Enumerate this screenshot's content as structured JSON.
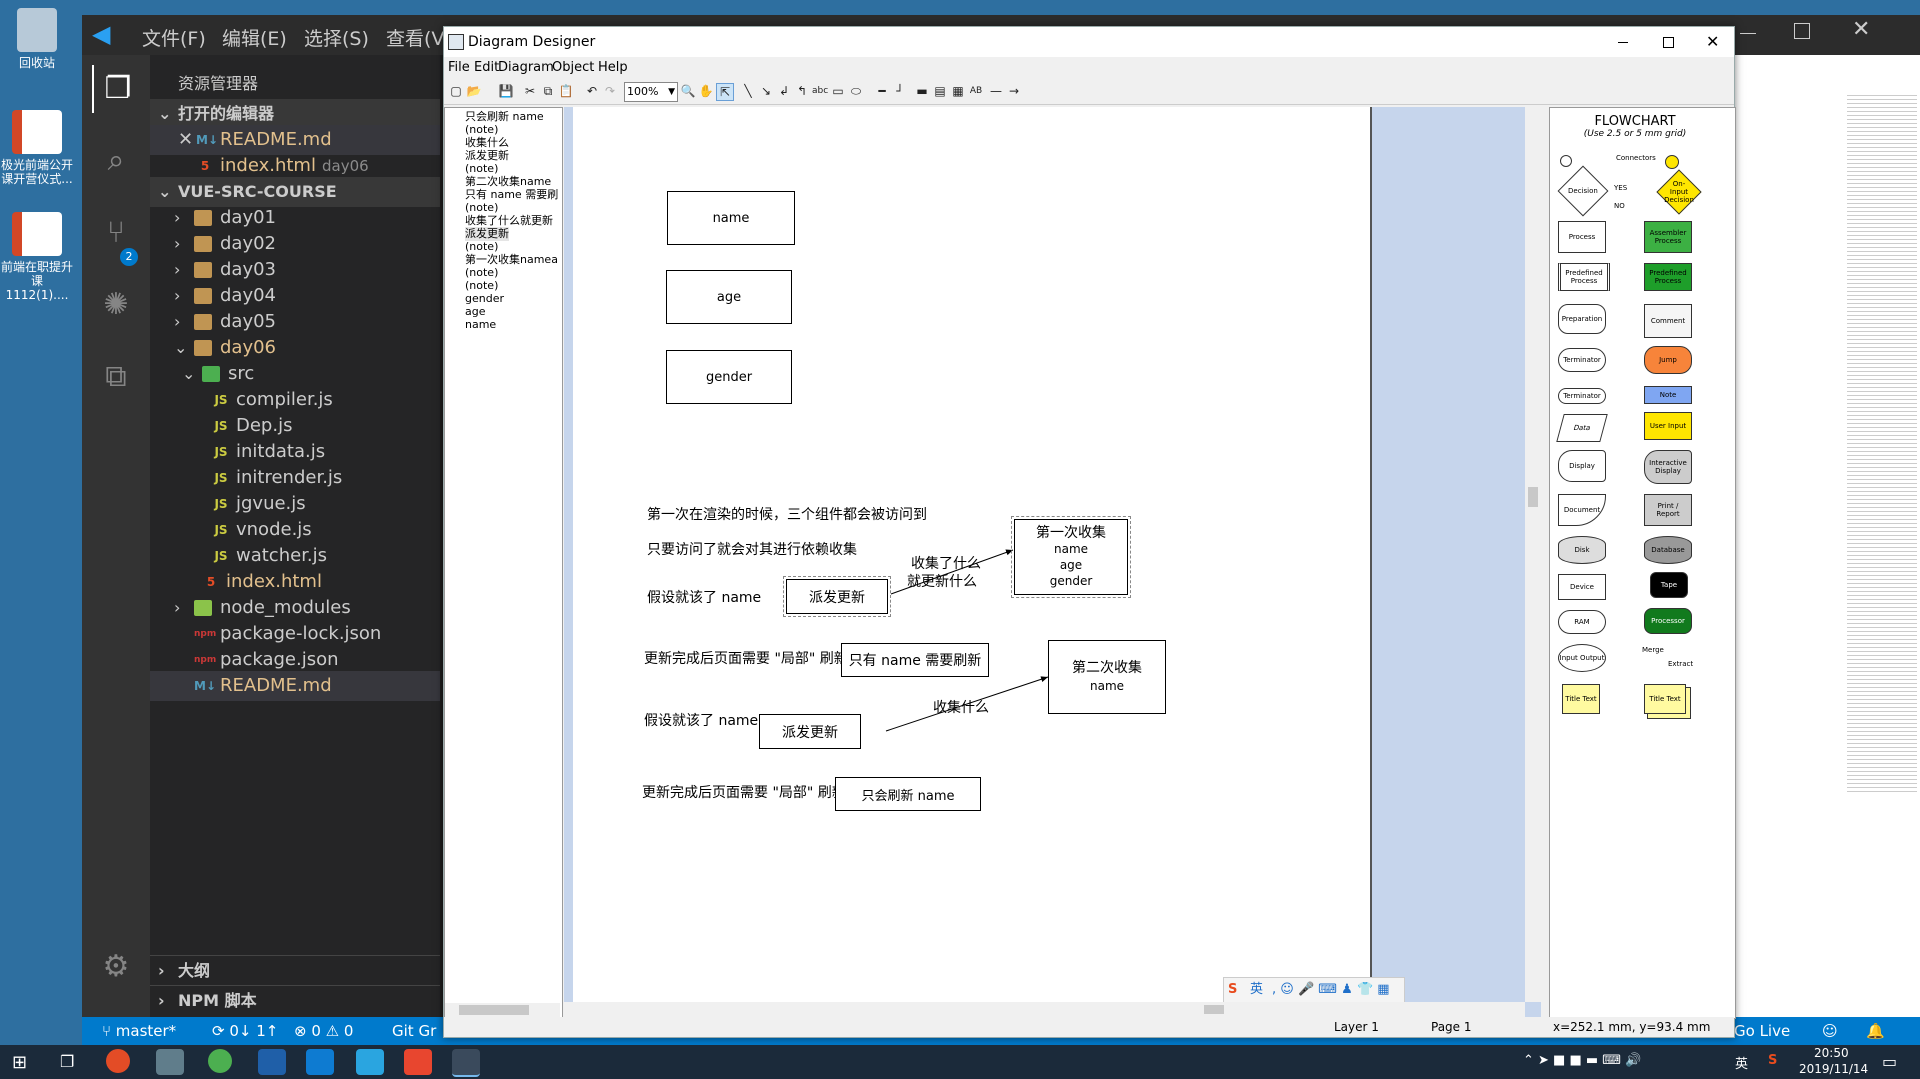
{
  "desktop": {
    "icons": [
      {
        "label": "回收站"
      },
      {
        "label": "极光前端公开课开营仪式..."
      },
      {
        "label": "前端在职提升课 1112(1)...."
      }
    ]
  },
  "vscode": {
    "menu": [
      "文件(F)",
      "编辑(E)",
      "选择(S)",
      "查看(V)"
    ],
    "explorer_title": "资源管理器",
    "open_editors": {
      "header": "打开的编辑器",
      "items": [
        {
          "name": "README.md",
          "icon": "markdown-icon"
        },
        {
          "name": "index.html",
          "detail": "day06",
          "icon": "html5-icon"
        }
      ]
    },
    "workspace": {
      "header": "VUE-SRC-COURSE",
      "folders": [
        "day01",
        "day02",
        "day03",
        "day04",
        "day05"
      ],
      "open_folder": "day06",
      "sub_folder": "src",
      "src_files": [
        "compiler.js",
        "Dep.js",
        "initdata.js",
        "initrender.js",
        "jgvue.js",
        "vnode.js",
        "watcher.js"
      ],
      "day06_files": [
        "index.html"
      ],
      "root_items": [
        "node_modules",
        "package-lock.json",
        "package.json",
        "README.md"
      ]
    },
    "outline": "大纲",
    "npm": "NPM 脚本",
    "scm_badge": "2",
    "status": {
      "branch": "master*",
      "sync": "0↓ 1↑",
      "problems": "0 ⚠ 0",
      "git": "Git Gr",
      "golive": "Go Live"
    }
  },
  "dd": {
    "title": "Diagram Designer",
    "menu": [
      "File",
      "Edit",
      "Diagram",
      "Object",
      "Help"
    ],
    "zoom": "100%",
    "tree": [
      "只会刷新 name",
      "(note)",
      "收集什么",
      "派发更新",
      "(note)",
      "第二次收集name",
      "只有 name 需要刷",
      "(note)",
      "收集了什么就更新",
      "派发更新",
      "(note)",
      "第一次收集namea",
      "(note)",
      "(note)",
      "gender",
      "age",
      "name"
    ],
    "boxes": {
      "name": "name",
      "age": "age",
      "gender": "gender",
      "dispatch1": "派发更新",
      "first_collect": [
        "第一次收集",
        "name",
        "age",
        "gender"
      ],
      "only_name": "只有 name 需要刷新",
      "second_collect": [
        "第二次收集",
        "name"
      ],
      "dispatch2": "派发更新",
      "only_refresh": "只会刷新 name"
    },
    "texts": {
      "t1": "第一次在渲染的时候，三个组件都会被访问到",
      "t2": "只要访问了就会对其进行依赖收集",
      "t3": "假设就该了 name",
      "t4": "收集了什么",
      "t5": "就更新什么",
      "t6": "更新完成后页面需要 \"局部\" 刷新",
      "t7": "假设就该了 name",
      "t8": "收集什么",
      "t9": "更新完成后页面需要 \"局部\" 刷新"
    },
    "palette": {
      "title": "FLOWCHART",
      "subtitle": "(Use 2.5 or 5 mm grid)",
      "shapes": [
        "Connectors",
        "Decision",
        "YES",
        "NO",
        "On-Input Decision",
        "Process",
        "Assembler Process",
        "Predefined Process",
        "Predefined Process",
        "Preparation",
        "Comment",
        "Terminator",
        "Jump",
        "Terminator",
        "Note",
        "Data",
        "User Input",
        "Display",
        "Interactive Display",
        "Document",
        "Print / Report",
        "Disk",
        "Database",
        "Device",
        "Tape",
        "RAM",
        "Processor",
        "Input Output",
        "Merge",
        "Extract",
        "Title Text",
        "Title Text"
      ]
    },
    "status": {
      "layer": "Layer 1",
      "page": "Page 1",
      "coords": "x=252.1 mm, y=93.4 mm"
    },
    "ime": "英"
  },
  "taskbar": {
    "time": "20:50",
    "date": "2019/11/14",
    "ime": "英"
  }
}
